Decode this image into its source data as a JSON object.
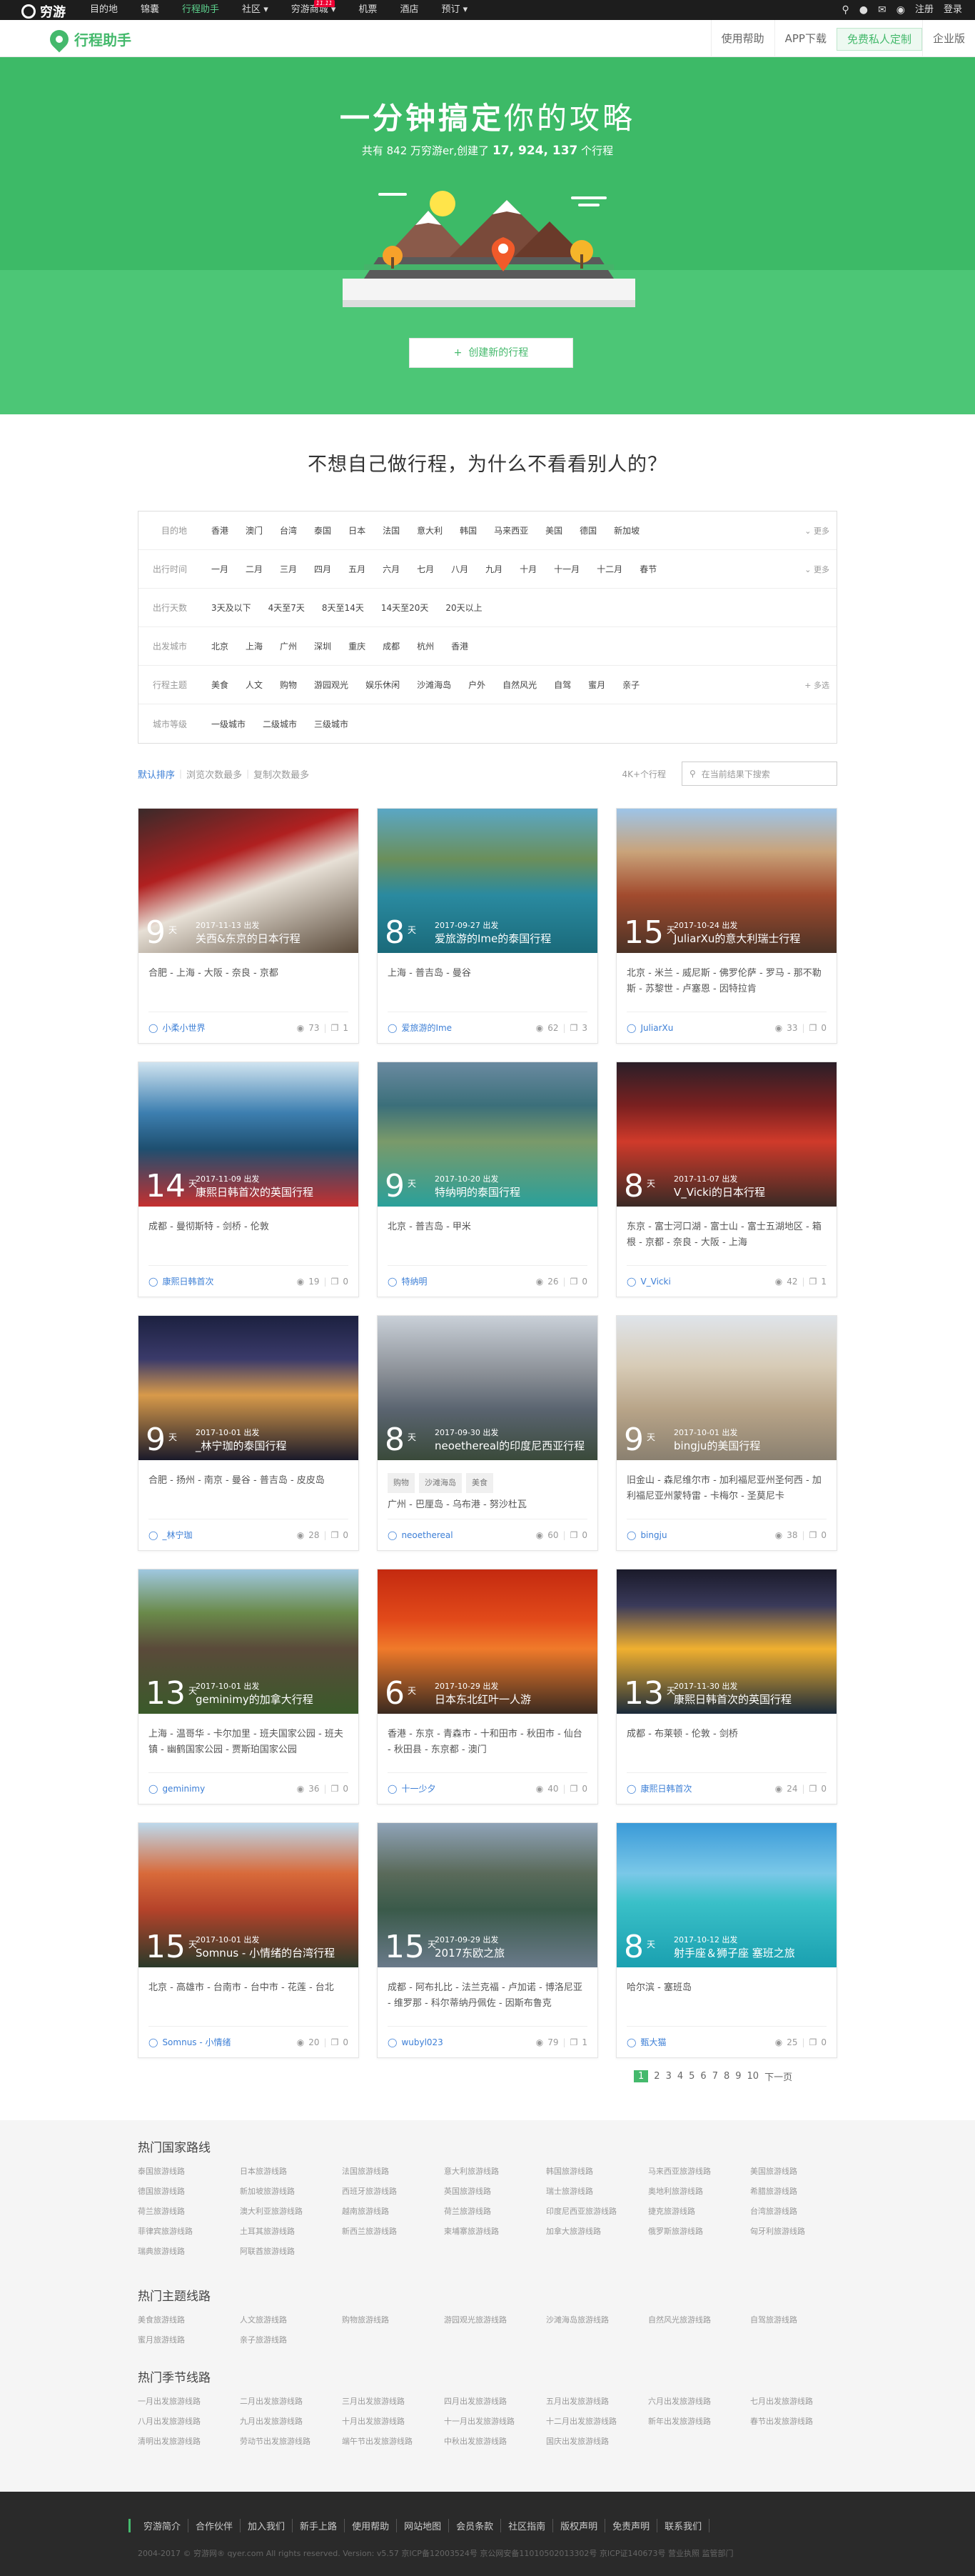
{
  "topbar": {
    "logo": "穷游",
    "nav": [
      "目的地",
      "锦囊",
      "行程助手",
      "社区",
      "穷游商城",
      "机票",
      "酒店",
      "预订"
    ],
    "badge": "11.11",
    "right": [
      "注册",
      "登录"
    ]
  },
  "subbar": {
    "brand": "行程助手",
    "nav": [
      "使用帮助",
      "APP下载",
      "免费私人定制",
      "企业版"
    ]
  },
  "hero": {
    "title_bold": "一分钟搞定",
    "title_rest": "你的攻略",
    "sub_pre": "共有 842 万穷游er,创建了",
    "sub_num": "17, 924, 137",
    "sub_post": "个行程",
    "create": "创建新的行程"
  },
  "question": "不想自己做行程，为什么不看看别人的？",
  "filters": [
    {
      "label": "目的地",
      "opts": [
        "香港",
        "澳门",
        "台湾",
        "泰国",
        "日本",
        "法国",
        "意大利",
        "韩国",
        "马来西亚",
        "美国",
        "德国",
        "新加坡"
      ],
      "more": "更多"
    },
    {
      "label": "出行时间",
      "opts": [
        "一月",
        "二月",
        "三月",
        "四月",
        "五月",
        "六月",
        "七月",
        "八月",
        "九月",
        "十月",
        "十一月",
        "十二月",
        "春节"
      ],
      "more": "更多"
    },
    {
      "label": "出行天数",
      "opts": [
        "3天及以下",
        "4天至7天",
        "8天至14天",
        "14天至20天",
        "20天以上"
      ],
      "more": ""
    },
    {
      "label": "出发城市",
      "opts": [
        "北京",
        "上海",
        "广州",
        "深圳",
        "重庆",
        "成都",
        "杭州",
        "香港"
      ],
      "more": ""
    },
    {
      "label": "行程主题",
      "opts": [
        "美食",
        "人文",
        "购物",
        "游园观光",
        "娱乐休闲",
        "沙滩海岛",
        "户外",
        "自然风光",
        "自驾",
        "蜜月",
        "亲子"
      ],
      "more": "多选"
    },
    {
      "label": "城市等级",
      "opts": [
        "一级城市",
        "二级城市",
        "三级城市"
      ],
      "more": ""
    }
  ],
  "sort": {
    "opts": [
      "默认排序",
      "浏览次数最多",
      "复制次数最多"
    ],
    "count": "4K+个行程",
    "search_placeholder": "在当前结果下搜索"
  },
  "cards": [
    {
      "days": "9",
      "date": "2017-11-13 出发",
      "title": "关西&东京的日本行程",
      "places": "合肥 - 上海 - 大阪 - 奈良 - 京都",
      "author": "小柔小世界",
      "views": "73",
      "copies": "1",
      "bg": "linear-gradient(160deg,#3a2a2a 0%,#b02020 35%,#e7e0d6 55%,#5a4a3a 100%)"
    },
    {
      "days": "8",
      "date": "2017-09-27 出发",
      "title": "爱旅游的Ime的泰国行程",
      "places": "上海 - 普吉岛 - 曼谷",
      "author": "爱旅游的Ime",
      "views": "62",
      "copies": "3",
      "bg": "linear-gradient(180deg,#5aa7c5 0%,#6b8f5a 35%,#2a8aa0 60%,#1a6a7a 100%)"
    },
    {
      "days": "15",
      "date": "2017-10-24 出发",
      "title": "JuliarXu的意大利瑞士行程",
      "places": "北京 - 米兰 - 威尼斯 - 佛罗伦萨 - 罗马 - 那不勒斯 - 苏黎世 - 卢塞恩 - 因特拉肯",
      "author": "JuliarXu",
      "views": "33",
      "copies": "0",
      "bg": "linear-gradient(180deg,#9dc4e8 0%,#c9a37a 30%,#a24b2e 60%,#4a3226 100%)"
    },
    {
      "days": "14",
      "date": "2017-11-09 出发",
      "title": "康熙日韩首次的英国行程",
      "places": "成都 - 曼彻斯特 - 剑桥 - 伦敦",
      "author": "康熙日韩首次",
      "views": "19",
      "copies": "0",
      "bg": "linear-gradient(180deg,#d0e4f0 0%,#3d7fb0 35%,#1e4f70 60%,#c53030 100%)"
    },
    {
      "days": "9",
      "date": "2017-10-20 出发",
      "title": "特纳明的泰国行程",
      "places": "北京 - 普吉岛 - 甲米",
      "author": "特纳明",
      "views": "26",
      "copies": "0",
      "bg": "linear-gradient(180deg,#6a8aa0 0%,#3b6f7a 30%,#7a9a6a 55%,#2aa09a 100%)"
    },
    {
      "days": "8",
      "date": "2017-11-07 出发",
      "title": "V_Vicki的日本行程",
      "places": "东京 - 富士河口湖 - 富士山 - 富士五湖地区 - 箱根 - 京都 - 奈良 - 大阪 - 上海",
      "author": "V_Vicki",
      "views": "42",
      "copies": "1",
      "bg": "linear-gradient(180deg,#2a1f28 0%,#7a2020 30%,#d03a2a 55%,#3a2a25 100%)"
    },
    {
      "days": "9",
      "date": "2017-10-01 出发",
      "title": "_林宁珈的泰国行程",
      "places": "合肥 - 扬州 - 南京 - 曼谷 - 普吉岛 - 皮皮岛",
      "author": "_林宁珈",
      "views": "28",
      "copies": "0",
      "bg": "linear-gradient(180deg,#1c2140 0%,#3a3a6a 30%,#d89a4a 55%,#1a1a2a 100%)"
    },
    {
      "days": "8",
      "date": "2017-09-30 出发",
      "title": "neoethereal的印度尼西亚行程",
      "places": "广州 - 巴厘岛 - 乌布港 - 努沙杜瓦",
      "tags": [
        "购物",
        "沙滩海岛",
        "美食"
      ],
      "author": "neoethereal",
      "views": "60",
      "copies": "0",
      "bg": "linear-gradient(180deg,#c9d0d8 0%,#8a8f96 40%,#5a6470 65%,#3a4a3a 100%)"
    },
    {
      "days": "9",
      "date": "2017-10-01 出发",
      "title": "bingju的美国行程",
      "places": "旧金山 - 森尼维尔市 - 加利福尼亚州圣何西 - 加利福尼亚州蒙特雷 - 卡梅尔 - 圣莫尼卡",
      "author": "bingju",
      "views": "38",
      "copies": "0",
      "bg": "linear-gradient(180deg,#dfe4ea 0%,#d7cbb6 35%,#b8a488 65%,#8a8070 100%)"
    },
    {
      "days": "13",
      "date": "2017-10-01 出发",
      "title": "geminimy的加拿大行程",
      "places": "上海 - 温哥华 - 卡尔加里 - 班夫国家公园 - 班夫镇 - 幽鹤国家公园 - 贾斯珀国家公园",
      "author": "geminimy",
      "views": "36",
      "copies": "0",
      "bg": "linear-gradient(180deg,#9fc8e0 0%,#6a8a4a 30%,#5a4a3a 55%,#3a5a2a 100%)"
    },
    {
      "days": "6",
      "date": "2017-10-29 出发",
      "title": "日本东北红叶一人游",
      "places": "香港 - 东京 - 青森市 - 十和田市 - 秋田市 - 仙台 - 秋田县 - 东京都 - 澳门",
      "author": "十一少夕",
      "views": "40",
      "copies": "0",
      "bg": "linear-gradient(180deg,#c42a10 0%,#e24a1a 35%,#f07a2a 55%,#3a2a20 100%)"
    },
    {
      "days": "13",
      "date": "2017-11-30 出发",
      "title": "康熙日韩首次的英国行程",
      "places": "成都 - 布莱顿 - 伦敦 - 剑桥",
      "author": "康熙日韩首次",
      "views": "24",
      "copies": "0",
      "bg": "linear-gradient(180deg,#1a1a2a 0%,#3a3a5a 25%,#f0b030 55%,#1a2a3a 100%)"
    },
    {
      "days": "15",
      "date": "2017-10-01 出发",
      "title": "Somnus - 小情绪的台湾行程",
      "places": "北京 - 高雄市 - 台南市 - 台中市 - 花莲 - 台北",
      "author": "Somnus - 小情绪",
      "views": "20",
      "copies": "0",
      "bg": "linear-gradient(180deg,#bcd9ec 0%,#d86a3a 35%,#b5432a 60%,#2a3a2a 100%)"
    },
    {
      "days": "15",
      "date": "2017-09-29 出发",
      "title": "2017东欧之旅",
      "places": "成都 - 阿布扎比 - 法兰克福 - 卢加诺 - 博洛尼亚 - 维罗那 - 科尔蒂纳丹佩佐 - 因斯布鲁克",
      "author": "wubyl023",
      "views": "79",
      "copies": "1",
      "bg": "linear-gradient(180deg,#8fa3b8 0%,#5a6a5a 35%,#3a5a4a 60%,#6a7a8a 100%)"
    },
    {
      "days": "8",
      "date": "2017-10-12 出发",
      "title": "射手座＆狮子座 塞班之旅",
      "places": "哈尔滨 - 塞班岛",
      "author": "甄大猫",
      "views": "25",
      "copies": "0",
      "bg": "linear-gradient(180deg,#3a9ad8 0%,#7ac8e8 35%,#3ac0c8 55%,#1aa0b0 100%)"
    }
  ],
  "pager": {
    "pages": [
      "1",
      "2",
      "3",
      "4",
      "5",
      "6",
      "7",
      "8",
      "9",
      "10"
    ],
    "next": "下一页"
  },
  "hot": [
    {
      "title": "热门国家路线",
      "links": [
        "泰国旅游线路",
        "日本旅游线路",
        "法国旅游线路",
        "意大利旅游线路",
        "韩国旅游线路",
        "马来西亚旅游线路",
        "美国旅游线路",
        "德国旅游线路",
        "新加坡旅游线路",
        "西班牙旅游线路",
        "英国旅游线路",
        "瑞士旅游线路",
        "奥地利旅游线路",
        "希腊旅游线路",
        "荷兰旅游线路",
        "澳大利亚旅游线路",
        "越南旅游线路",
        "荷兰旅游线路",
        "印度尼西亚旅游线路",
        "捷克旅游线路",
        "台湾旅游线路",
        "菲律宾旅游线路",
        "土耳其旅游线路",
        "新西兰旅游线路",
        "柬埔寨旅游线路",
        "加拿大旅游线路",
        "俄罗斯旅游线路",
        "匈牙利旅游线路",
        "瑞典旅游线路",
        "阿联酋旅游线路"
      ]
    },
    {
      "title": "热门主题线路",
      "links": [
        "美食旅游线路",
        "人文旅游线路",
        "购物旅游线路",
        "游园观光旅游线路",
        "沙滩海岛旅游线路",
        "自然风光旅游线路",
        "自驾旅游线路",
        "蜜月旅游线路",
        "亲子旅游线路"
      ]
    },
    {
      "title": "热门季节线路",
      "links": [
        "一月出发旅游线路",
        "二月出发旅游线路",
        "三月出发旅游线路",
        "四月出发旅游线路",
        "五月出发旅游线路",
        "六月出发旅游线路",
        "七月出发旅游线路",
        "八月出发旅游线路",
        "九月出发旅游线路",
        "十月出发旅游线路",
        "十一月出发旅游线路",
        "十二月出发旅游线路",
        "新年出发旅游线路",
        "春节出发旅游线路",
        "清明出发旅游线路",
        "劳动节出发旅游线路",
        "端午节出发旅游线路",
        "中秋出发旅游线路",
        "国庆出发旅游线路"
      ]
    }
  ],
  "footer": {
    "links": [
      "穷游简介",
      "合作伙伴",
      "加入我们",
      "新手上路",
      "使用帮助",
      "网站地图",
      "会员条款",
      "社区指南",
      "版权声明",
      "免责声明",
      "联系我们"
    ],
    "copy": "2004-2017 © 穷游网® qyer.com All rights reserved. Version: v5.57  京ICP备12003524号  京公网安备11010502013302号  京ICP证140673号  营业执照  监管部门"
  }
}
